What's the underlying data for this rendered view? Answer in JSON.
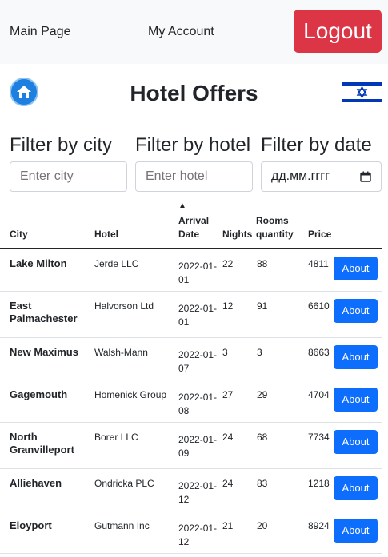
{
  "nav": {
    "main_page": "Main Page",
    "my_account": "My Account",
    "logout": "Logout"
  },
  "header": {
    "title": "Hotel Offers",
    "home_icon": "home-icon",
    "flag_icon": "israel-flag-icon"
  },
  "filters": {
    "city": {
      "label": "Filter by city",
      "placeholder": "Enter city"
    },
    "hotel": {
      "label": "Filter by hotel",
      "placeholder": "Enter hotel"
    },
    "date": {
      "label": "Filter by date",
      "value": "дд.мм.гггг"
    }
  },
  "table": {
    "headers": {
      "city": "City",
      "hotel": "Hotel",
      "arrival_date": "Arrival Date",
      "nights": "Nights",
      "rooms": "Rooms quantity",
      "price": "Price"
    },
    "sort_indicator": "▲",
    "about_label": "About",
    "rows": [
      {
        "city": "Lake Milton",
        "hotel": "Jerde LLC",
        "date": "2022-01-01",
        "nights": "22",
        "rooms": "88",
        "price": "4811"
      },
      {
        "city": "East Palmachester",
        "hotel": "Halvorson Ltd",
        "date": "2022-01-01",
        "nights": "12",
        "rooms": "91",
        "price": "6610"
      },
      {
        "city": "New Maximus",
        "hotel": "Walsh-Mann",
        "date": "2022-01-07",
        "nights": "3",
        "rooms": "3",
        "price": "8663"
      },
      {
        "city": "Gagemouth",
        "hotel": "Homenick Group",
        "date": "2022-01-08",
        "nights": "27",
        "rooms": "29",
        "price": "4704"
      },
      {
        "city": "North Granvilleport",
        "hotel": "Borer LLC",
        "date": "2022-01-09",
        "nights": "24",
        "rooms": "68",
        "price": "7734"
      },
      {
        "city": "Alliehaven",
        "hotel": "Ondricka PLC",
        "date": "2022-01-12",
        "nights": "24",
        "rooms": "83",
        "price": "1218"
      },
      {
        "city": "Eloyport",
        "hotel": "Gutmann Inc",
        "date": "2022-01-12",
        "nights": "21",
        "rooms": "20",
        "price": "8924"
      }
    ]
  },
  "colors": {
    "navbar_bg": "#f8f9fa",
    "logout": "#dc3545",
    "primary": "#0d6efd",
    "flag_blue": "#0038b8"
  }
}
